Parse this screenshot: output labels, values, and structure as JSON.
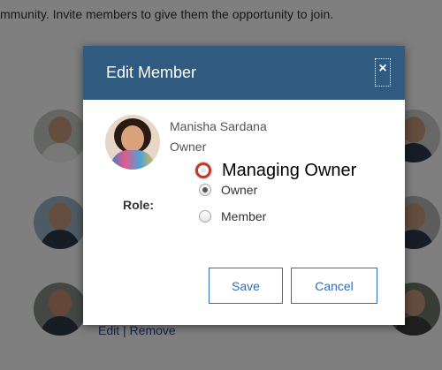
{
  "background": {
    "intro_text": "mmunity. Invite members to give them the opportunity to join.",
    "edit_link": "Edit",
    "separator": "|",
    "remove_link": "Remove"
  },
  "modal": {
    "title": "Edit Member",
    "close_label": "×",
    "member_name": "Manisha Sardana",
    "member_current_role": "Owner",
    "role_label": "Role:",
    "annotation_label": "Managing Owner",
    "role_options": [
      {
        "label": "Owner",
        "selected": true
      },
      {
        "label": "Member",
        "selected": false
      }
    ],
    "save_label": "Save",
    "cancel_label": "Cancel"
  },
  "colors": {
    "header_bg": "#2f5b81",
    "button_accent": "#2f6eb5",
    "annotation_ring": "#c0392b",
    "link": "#2a4b88"
  }
}
